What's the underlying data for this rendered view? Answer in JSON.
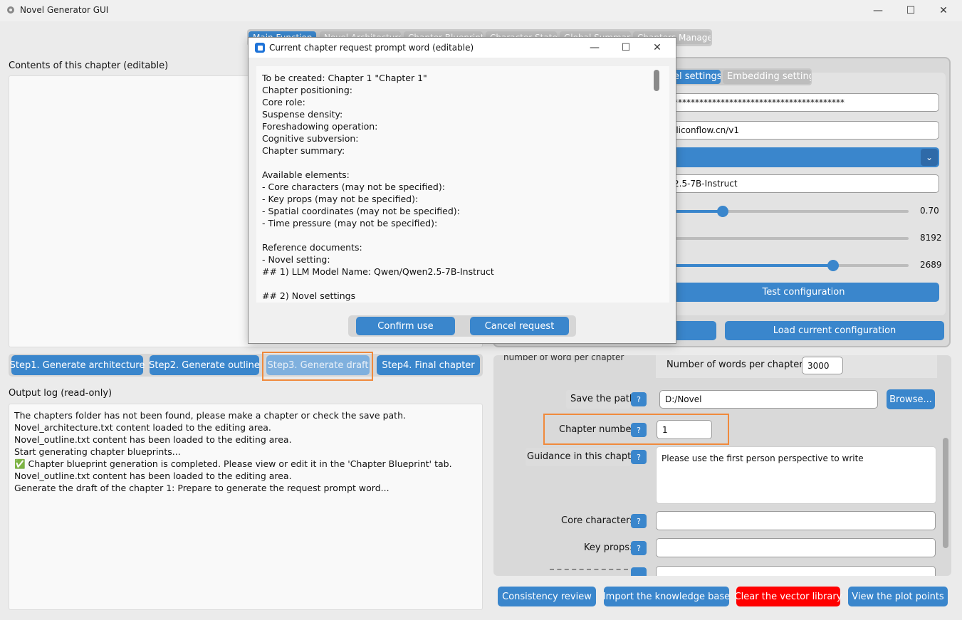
{
  "window": {
    "title": "Novel Generator GUI"
  },
  "tabs": [
    "Main Function",
    "Novel Architecture",
    "Chapter Blueprint",
    "Character State",
    "Global Summary",
    "Chapters Manage"
  ],
  "left": {
    "contents_label": "Contents of this chapter (editable)",
    "steps": [
      "Step1. Generate architecture",
      "Step2. Generate outline",
      "Step3. Generate draft",
      "Step4. Final chapter"
    ],
    "log_label": "Output log (read-only)",
    "log_lines": [
      "The chapters folder has not been found, please make a chapter or check the save path.",
      "Novel_architecture.txt content loaded to the editing area.",
      "Novel_outline.txt content has been loaded to the editing area.",
      "Start generating chapter blueprints...",
      "✅ Chapter blueprint generation is completed. Please view or edit it in the 'Chapter Blueprint' tab.",
      "Novel_outline.txt content has been loaded to the editing area.",
      "Generate the draft of the chapter 1: Prepare to generate the request prompt word..."
    ]
  },
  "config": {
    "tab_model": "el settings",
    "tab_embedding": "Embedding settings",
    "api_key_masked": "****************************************",
    "base_url": "iliconflow.cn/v1",
    "model_name": "2.5-7B-Instruct",
    "temperature": "0.70",
    "temperature_fraction": 0.21,
    "max_tokens": "8192",
    "max_tokens_fraction": 1.0,
    "timeout": "2689",
    "timeout_fraction": 0.68,
    "test_button": "Test configuration",
    "load_button": "Load current configuration"
  },
  "params": {
    "words_label_cut": "number of word per chapter",
    "words_label": "Number of words per chapter:",
    "words_value": "3000",
    "save_path_label": "Save the path:",
    "save_path_value": "D:/Novel",
    "browse": "Browse...",
    "chapter_number_label": "Chapter number:",
    "chapter_number_value": "1",
    "guidance_label": "Guidance in this chapter:",
    "guidance_value": "Please use the first person perspective to write",
    "core_characters_label": "Core characters:",
    "key_props_label": "Key props:",
    "help": "?"
  },
  "bottom_buttons": [
    "Consistency review",
    "Import the knowledge base",
    "Clear the vector library",
    "View the plot points"
  ],
  "colors": {
    "accent": "#3a86cc",
    "danger": "#ff0000",
    "highlight": "#f08a3c"
  },
  "dialog": {
    "title": "Current chapter request prompt word (editable)",
    "lines": [
      "To be created: Chapter 1 \"Chapter 1\"",
      "Chapter positioning:",
      "Core role:",
      "Suspense density:",
      "Foreshadowing operation:",
      "Cognitive subversion:",
      "Chapter summary:",
      "",
      "Available elements:",
      "- Core characters (may not be specified):",
      "- Key props (may not be specified):",
      "- Spatial coordinates (may not be specified):",
      "- Time pressure (may not be specified):",
      "",
      "Reference documents:",
      "- Novel setting:",
      "## 1) LLM Model Name: Qwen/Qwen2.5-7B-Instruct",
      "",
      "## 2) Novel settings"
    ],
    "confirm": "Confirm use",
    "cancel": "Cancel request"
  }
}
